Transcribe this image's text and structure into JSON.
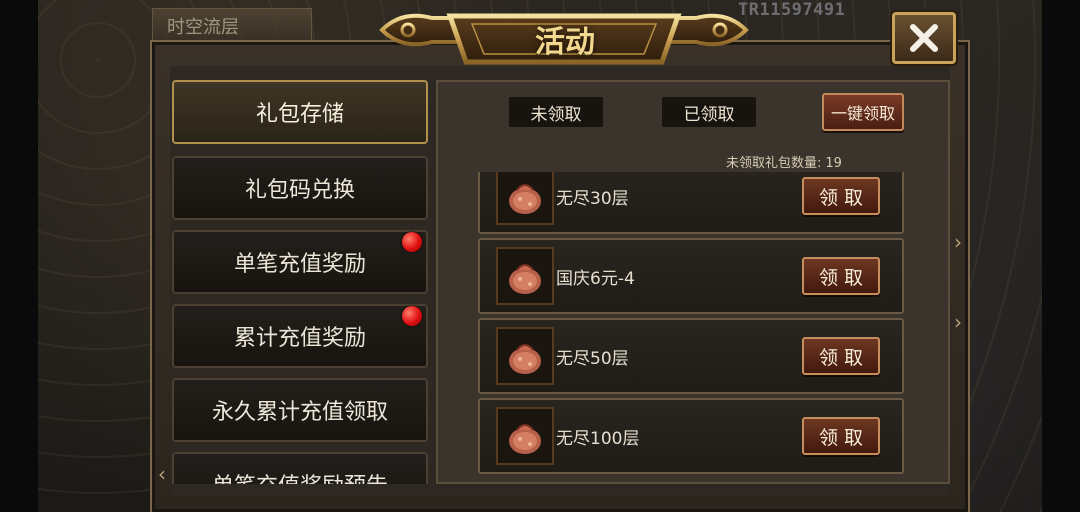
{
  "window": {
    "title": "活动",
    "top_left_label": "时空流层",
    "top_id": "TR11597491"
  },
  "left_menu": {
    "items": [
      {
        "label": "礼包存储",
        "active": true,
        "badge": false
      },
      {
        "label": "礼包码兑换",
        "active": false,
        "badge": false
      },
      {
        "label": "单笔充值奖励",
        "active": false,
        "badge": true
      },
      {
        "label": "累计充值奖励",
        "active": false,
        "badge": true
      },
      {
        "label": "永久累计充值领取",
        "active": false,
        "badge": false
      },
      {
        "label": "单笔充值奖励预告",
        "active": false,
        "badge": false
      }
    ]
  },
  "right_panel": {
    "tabs": [
      {
        "label": "未领取"
      },
      {
        "label": "已领取"
      }
    ],
    "claim_all_label": "一键领取",
    "unclaimed_label": "未领取礼包数量:",
    "unclaimed_count": "19",
    "gifts": [
      {
        "name": "无尽30层",
        "claim_label": "领 取",
        "icon": "gift-bag-icon"
      },
      {
        "name": "国庆6元-4",
        "claim_label": "领 取",
        "icon": "gift-bag-icon"
      },
      {
        "name": "无尽50层",
        "claim_label": "领 取",
        "icon": "gift-bag-icon"
      },
      {
        "name": "无尽100层",
        "claim_label": "领 取",
        "icon": "gift-bag-icon"
      }
    ]
  },
  "colors": {
    "title_gold": "#f3d98f",
    "badge_red": "#e01010",
    "button_red": "#6e3722",
    "frame_gold": "#c8a45a"
  }
}
